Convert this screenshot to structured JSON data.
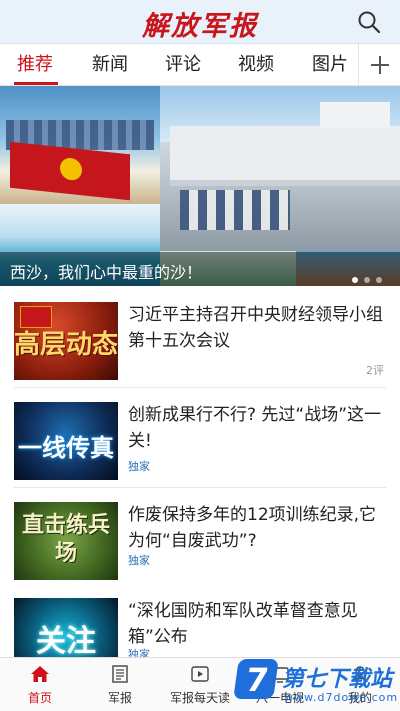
{
  "header": {
    "logo_text": "解放军报",
    "search_icon": "search-icon"
  },
  "tabs": [
    {
      "label": "推荐",
      "active": true
    },
    {
      "label": "新闻",
      "active": false
    },
    {
      "label": "评论",
      "active": false
    },
    {
      "label": "视频",
      "active": false
    },
    {
      "label": "图片",
      "active": false
    }
  ],
  "tab_add_icon": "plus-icon",
  "banner": {
    "caption": "西沙，我们心中最重的沙！",
    "slide_count": 3,
    "active_slide": 1
  },
  "news": [
    {
      "title": "习近平主持召开中央财经领导小组第十五次会议",
      "thumb_text": "高层动态",
      "meta": "2评",
      "tag": ""
    },
    {
      "title": "创新成果行不行? 先过“战场”这一关!",
      "thumb_text": "一线传真",
      "meta": "",
      "tag": "独家"
    },
    {
      "title": "作废保持多年的12项训练纪录,它为何“自废武功”?",
      "thumb_text": "直击练兵场",
      "meta": "",
      "tag": "独家"
    },
    {
      "title": "“深化国防和军队改革督查意见箱”公布",
      "thumb_text": "关注",
      "meta": "",
      "tag": "独家"
    }
  ],
  "bottom_nav": [
    {
      "label": "首页",
      "icon": "home-icon",
      "active": true
    },
    {
      "label": "军报",
      "icon": "newspaper-icon",
      "active": false
    },
    {
      "label": "军报每天读",
      "icon": "play-icon",
      "active": false
    },
    {
      "label": "八一电视",
      "icon": "tv-icon",
      "active": false
    },
    {
      "label": "我的",
      "icon": "user-icon",
      "active": false
    }
  ],
  "watermark": {
    "title": "第七下载站",
    "url": "www.d7down.com"
  },
  "colors": {
    "accent": "#d0121b",
    "header_bg": "#e9f2fb",
    "tag_blue": "#2b73b8"
  }
}
